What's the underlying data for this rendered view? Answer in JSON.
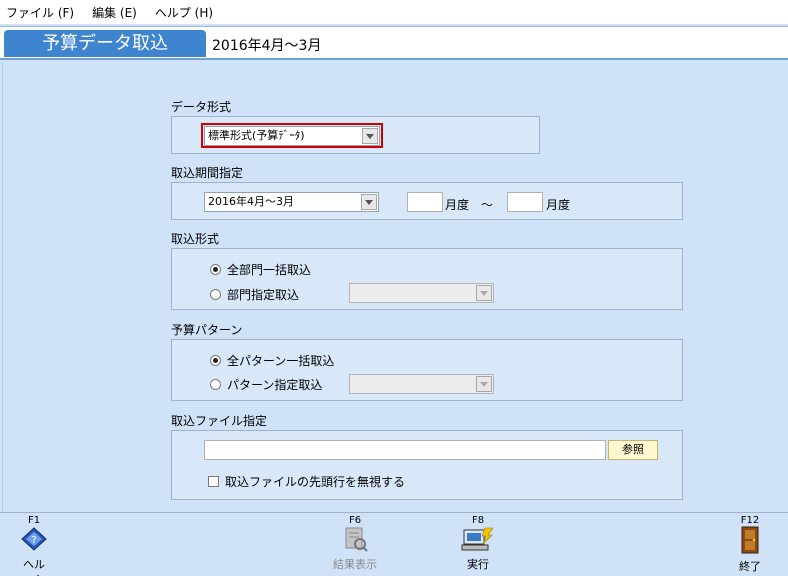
{
  "menubar": {
    "items": [
      {
        "label": "ファイル (F)"
      },
      {
        "label": "編集 (E)"
      },
      {
        "label": "ヘルプ (H)"
      }
    ]
  },
  "header": {
    "title": "予算データ取込",
    "period": "2016年4月～3月"
  },
  "form": {
    "data_format": {
      "label": "データ形式",
      "selected": "標準形式(予算ﾃﾞｰﾀ)"
    },
    "period_spec": {
      "label": "取込期間指定",
      "selected": "2016年4月～3月",
      "from_value": "",
      "from_suffix": "月度",
      "separator": "～",
      "to_value": "",
      "to_suffix": "月度"
    },
    "import_format": {
      "label": "取込形式",
      "options": [
        {
          "label": "全部門一括取込",
          "checked": true
        },
        {
          "label": "部門指定取込",
          "checked": false
        }
      ],
      "dept_selected": ""
    },
    "budget_pattern": {
      "label": "予算パターン",
      "options": [
        {
          "label": "全パターン一括取込",
          "checked": true
        },
        {
          "label": "パターン指定取込",
          "checked": false
        }
      ],
      "pattern_selected": ""
    },
    "file_spec": {
      "label": "取込ファイル指定",
      "path_value": "",
      "browse_label": "参照",
      "ignore_first_row_label": "取込ファイルの先頭行を無視する",
      "ignore_first_row_checked": false
    }
  },
  "fnbar": {
    "f1": {
      "key": "F1",
      "label": "ヘルプ",
      "icon": "help-book-icon"
    },
    "f6": {
      "key": "F6",
      "label": "結果表示",
      "icon": "result-view-icon",
      "enabled": false
    },
    "f8": {
      "key": "F8",
      "label": "実行",
      "icon": "execute-computer-icon"
    },
    "f12": {
      "key": "F12",
      "label": "終了",
      "icon": "exit-door-icon"
    }
  },
  "colors": {
    "background": "#cfe2f7",
    "title_tab": "#3f84cf",
    "highlight": "#d00000",
    "browse_button": "#fff8d0"
  }
}
